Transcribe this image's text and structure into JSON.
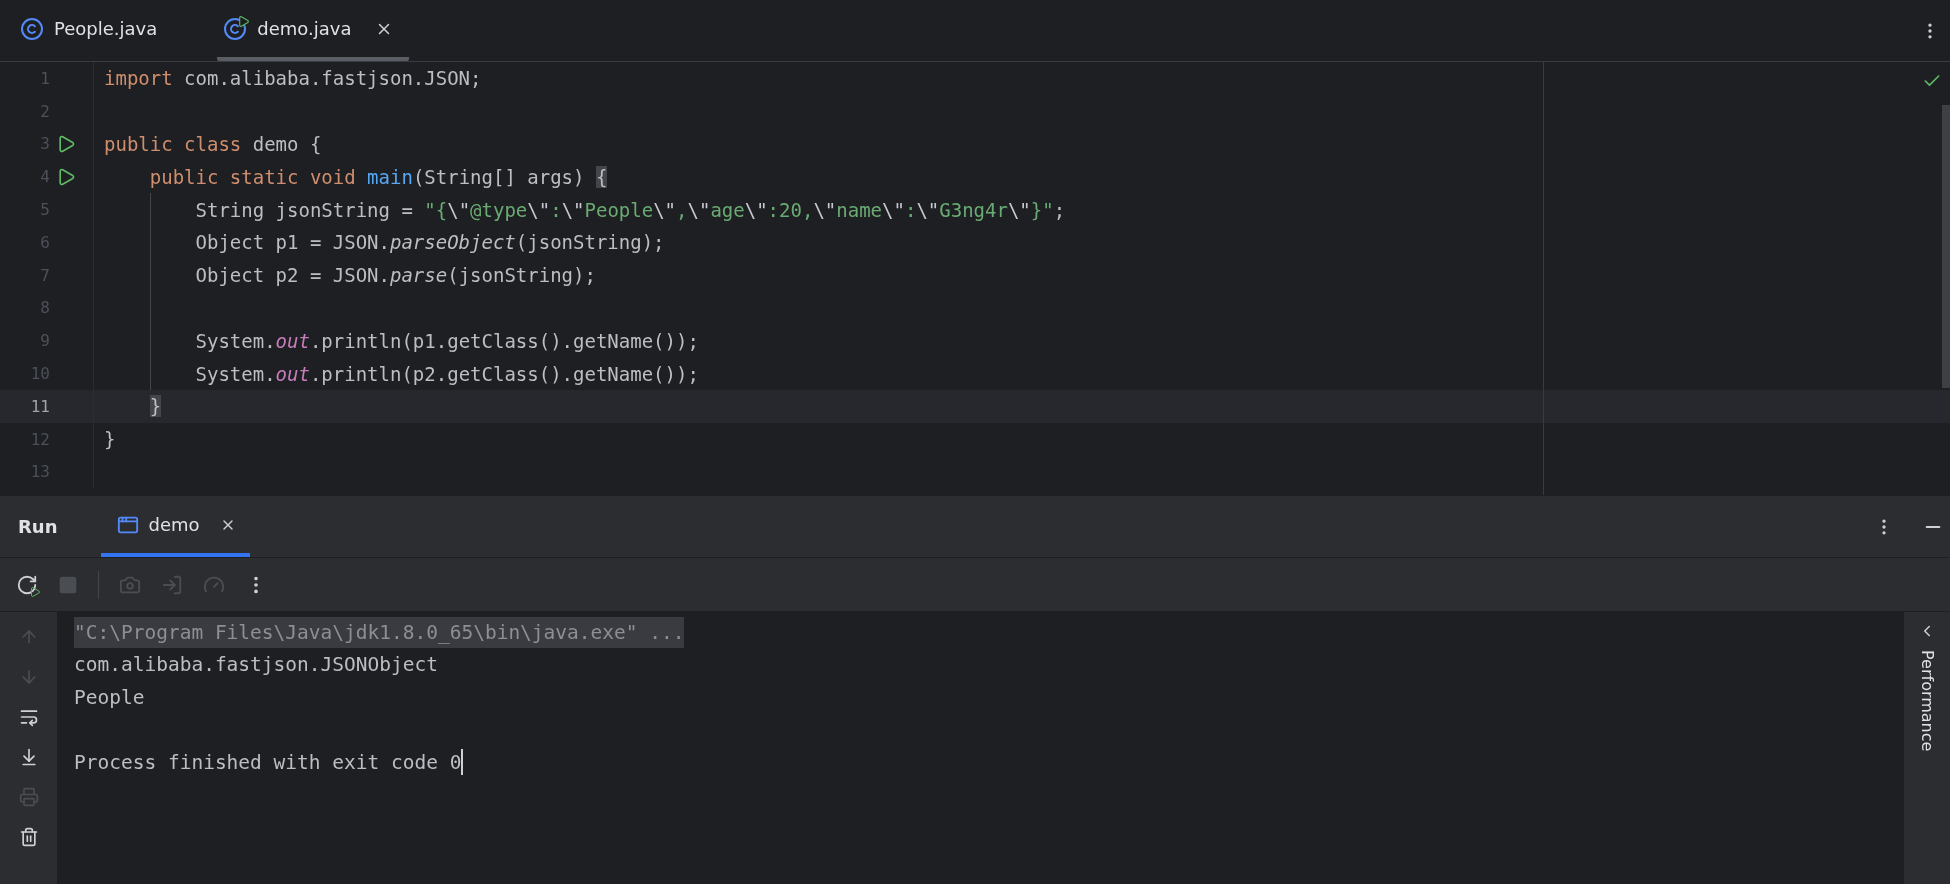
{
  "editor_tabs": [
    {
      "label": "People.java",
      "selected": false,
      "runnable": false,
      "closable": false
    },
    {
      "label": "demo.java",
      "selected": true,
      "runnable": true,
      "closable": true
    }
  ],
  "editor": {
    "inspection_ok": true,
    "lines": [
      {
        "number": "1",
        "current": false,
        "run": false,
        "guide": false,
        "segments": [
          {
            "kind": "keyword",
            "text": "import "
          },
          {
            "kind": "plain",
            "text": "com.alibaba.fastjson.JSON;"
          }
        ]
      },
      {
        "number": "2",
        "current": false,
        "run": false,
        "guide": false
      },
      {
        "number": "3",
        "current": false,
        "run": true,
        "guide": false,
        "segments": [
          {
            "kind": "keyword",
            "text": "public class "
          },
          {
            "kind": "plain",
            "text": "demo {"
          }
        ]
      },
      {
        "number": "4",
        "current": false,
        "run": true,
        "guide": false,
        "segments": [
          {
            "kind": "keyword",
            "text": "    public static void "
          },
          {
            "kind": "method",
            "text": "main"
          },
          {
            "kind": "plain",
            "text": "(String[] args) "
          },
          {
            "kind": "brace",
            "text": "{"
          }
        ]
      },
      {
        "number": "5",
        "current": false,
        "run": false,
        "guide": true,
        "segments": [
          {
            "kind": "plain",
            "text": "        String jsonString = "
          },
          {
            "kind": "string",
            "text": "\"{"
          },
          {
            "kind": "escape",
            "text": "\\\""
          },
          {
            "kind": "string",
            "text": "@type"
          },
          {
            "kind": "escape",
            "text": "\\\""
          },
          {
            "kind": "string",
            "text": ":"
          },
          {
            "kind": "escape",
            "text": "\\\""
          },
          {
            "kind": "string",
            "text": "People"
          },
          {
            "kind": "escape",
            "text": "\\\""
          },
          {
            "kind": "string",
            "text": ","
          },
          {
            "kind": "escape",
            "text": "\\\""
          },
          {
            "kind": "string",
            "text": "age"
          },
          {
            "kind": "escape",
            "text": "\\\""
          },
          {
            "kind": "string",
            "text": ":20,"
          },
          {
            "kind": "escape",
            "text": "\\\""
          },
          {
            "kind": "string",
            "text": "name"
          },
          {
            "kind": "escape",
            "text": "\\\""
          },
          {
            "kind": "string",
            "text": ":"
          },
          {
            "kind": "escape",
            "text": "\\\""
          },
          {
            "kind": "string",
            "text": "G3ng4r"
          },
          {
            "kind": "escape",
            "text": "\\\""
          },
          {
            "kind": "string",
            "text": "}\""
          },
          {
            "kind": "plain",
            "text": ";"
          }
        ]
      },
      {
        "number": "6",
        "current": false,
        "run": false,
        "guide": true,
        "segments": [
          {
            "kind": "plain",
            "text": "        Object p1 = JSON."
          },
          {
            "kind": "static_call",
            "text": "parseObject"
          },
          {
            "kind": "plain",
            "text": "(jsonString);"
          }
        ]
      },
      {
        "number": "7",
        "current": false,
        "run": false,
        "guide": true,
        "segments": [
          {
            "kind": "plain",
            "text": "        Object p2 = JSON."
          },
          {
            "kind": "static_call",
            "text": "parse"
          },
          {
            "kind": "plain",
            "text": "(jsonString);"
          }
        ]
      },
      {
        "number": "8",
        "current": false,
        "run": false,
        "guide": true
      },
      {
        "number": "9",
        "current": false,
        "run": false,
        "guide": true,
        "segments": [
          {
            "kind": "plain",
            "text": "        System."
          },
          {
            "kind": "static_field",
            "text": "out"
          },
          {
            "kind": "plain",
            "text": ".println(p1.getClass().getName());"
          }
        ]
      },
      {
        "number": "10",
        "current": false,
        "run": false,
        "guide": true,
        "segments": [
          {
            "kind": "plain",
            "text": "        System."
          },
          {
            "kind": "static_field",
            "text": "out"
          },
          {
            "kind": "plain",
            "text": ".println(p2.getClass().getName());"
          }
        ]
      },
      {
        "number": "11",
        "current": true,
        "run": false,
        "guide": false,
        "segments": [
          {
            "kind": "indent"
          },
          {
            "kind": "brace",
            "text": "}"
          }
        ]
      },
      {
        "number": "12",
        "current": false,
        "run": false,
        "guide": false,
        "segments": [
          {
            "kind": "plain",
            "text": "}"
          }
        ]
      },
      {
        "number": "13",
        "current": false,
        "run": false,
        "guide": false
      }
    ]
  },
  "run_panel": {
    "title": "Run",
    "tabs": [
      {
        "label": "demo",
        "selected": true
      }
    ],
    "toolbar": [
      {
        "kind": "rerun",
        "disabled": false
      },
      {
        "kind": "stop",
        "disabled": true
      },
      {
        "kind": "separator"
      },
      {
        "kind": "screenshot",
        "disabled": true
      },
      {
        "kind": "attach",
        "disabled": true
      },
      {
        "kind": "profile",
        "disabled": true
      },
      {
        "kind": "more",
        "disabled": false
      }
    ],
    "console_actions": [
      {
        "kind": "up",
        "disabled": true
      },
      {
        "kind": "down",
        "disabled": true
      },
      {
        "kind": "wrap",
        "disabled": false
      },
      {
        "kind": "scroll_end",
        "disabled": false
      },
      {
        "kind": "print",
        "disabled": true
      },
      {
        "kind": "clear",
        "disabled": false
      }
    ],
    "console": [
      {
        "kind": "command",
        "text": "\"C:\\Program Files\\Java\\jdk1.8.0_65\\bin\\java.exe\" ..."
      },
      {
        "kind": "output",
        "text": "com.alibaba.fastjson.JSONObject"
      },
      {
        "kind": "output",
        "text": "People"
      },
      {
        "kind": "blank"
      },
      {
        "kind": "exit",
        "text": "Process finished with exit code 0",
        "caret": true
      }
    ],
    "side_tab": "Performance"
  }
}
